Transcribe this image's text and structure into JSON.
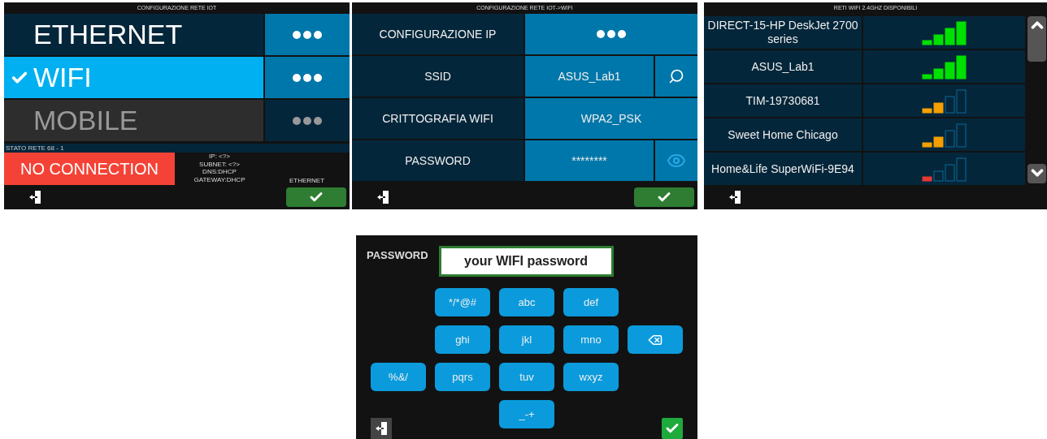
{
  "network_panel": {
    "title": "CONFIGURAZIONE RETE IOT",
    "interfaces": [
      {
        "label": "ETHERNET",
        "selected": false,
        "disabled": false
      },
      {
        "label": "WIFI",
        "selected": true,
        "disabled": false
      },
      {
        "label": "MOBILE",
        "selected": false,
        "disabled": true
      }
    ],
    "status_label": "STATO RETE 68 - 1",
    "connection_status": "NO CONNECTION",
    "info_lines": [
      "IP: <?>",
      "SUBNET: <?>",
      "DNS:DHCP",
      "GATEWAY:DHCP"
    ],
    "active_interface": "ETHERNET"
  },
  "wifi_panel": {
    "title": "CONFIGURAZIONE RETE IOT->WIFI",
    "rows": [
      {
        "label": "CONFIGURAZIONE IP",
        "kind": "menu"
      },
      {
        "label": "SSID",
        "kind": "lookup",
        "value": "ASUS_Lab1"
      },
      {
        "label": "CRITTOGRAFIA WIFI",
        "kind": "value",
        "value": "WPA2_PSK"
      },
      {
        "label": "PASSWORD",
        "kind": "secret",
        "value": "********"
      }
    ]
  },
  "networks_panel": {
    "title": "RETI WIFI 2.4GHZ DISPONIBILI",
    "networks": [
      {
        "name": "DIRECT-15-HP DeskJet 2700 series",
        "level": 1
      },
      {
        "name": "ASUS_Lab1",
        "level": 1
      },
      {
        "name": "TIM-19730681",
        "level": 0.5
      },
      {
        "name": "Sweet Home Chicago",
        "level": 0.5
      },
      {
        "name": "Home&Life SuperWiFi-9E94",
        "level": 0.25
      }
    ]
  },
  "keyboard_panel": {
    "label": "PASSWORD",
    "placeholder": "your WIFI password",
    "rows": [
      {
        "keys": [
          {
            "kind": "char",
            "label": "*/*@#"
          },
          {
            "kind": "char",
            "label": "abc"
          },
          {
            "kind": "char",
            "label": "def"
          }
        ]
      },
      {
        "keys": [
          {
            "kind": "char",
            "label": "ghi"
          },
          {
            "kind": "char",
            "label": "jkl"
          },
          {
            "kind": "char",
            "label": "mno"
          },
          {
            "kind": "backspace"
          }
        ]
      },
      {
        "keys": [
          {
            "kind": "char",
            "label": "%&/"
          },
          {
            "kind": "char",
            "label": "pqrs"
          },
          {
            "kind": "char",
            "label": "tuv"
          },
          {
            "kind": "char",
            "label": "wxyz"
          }
        ]
      },
      {
        "keys": [
          {
            "kind": "char",
            "label": "_-+"
          }
        ]
      }
    ]
  }
}
